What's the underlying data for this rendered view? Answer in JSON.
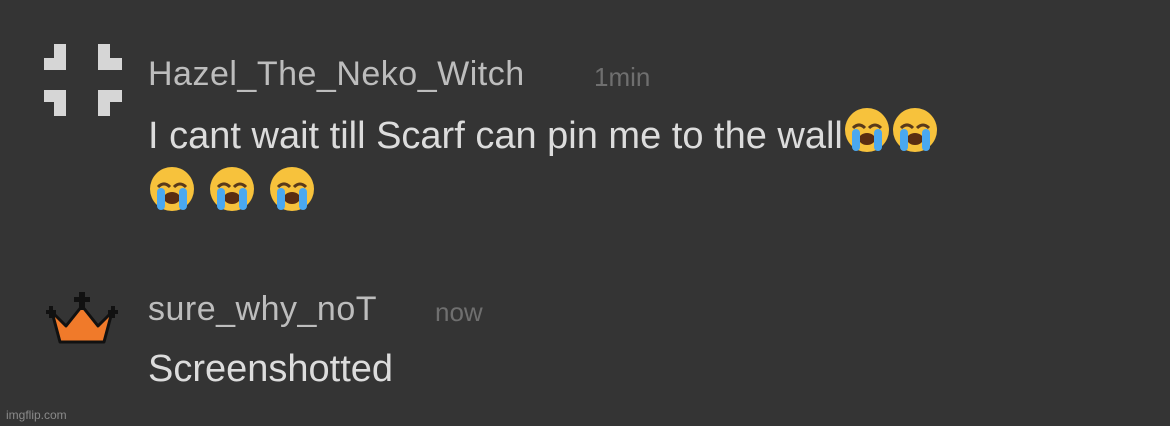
{
  "comments": [
    {
      "username": "Hazel_The_Neko_Witch",
      "time": "1min",
      "message_text": "I cant wait till Scarf can pin me to the wall",
      "avatar_icon": "cross-blocks-icon",
      "emoji_icon": "loudly-crying-face-icon",
      "emoji_count": 5
    },
    {
      "username": "sure_why_noT",
      "time": "now",
      "message_text": "Screenshotted",
      "avatar_icon": "crown-icon",
      "avatar_color": "#f07a2a"
    }
  ],
  "watermark": "imgflip.com",
  "colors": {
    "background": "#343434",
    "username": "#bdbdbd",
    "timestamp": "#6f6f6f",
    "message": "#dcdcdc"
  }
}
